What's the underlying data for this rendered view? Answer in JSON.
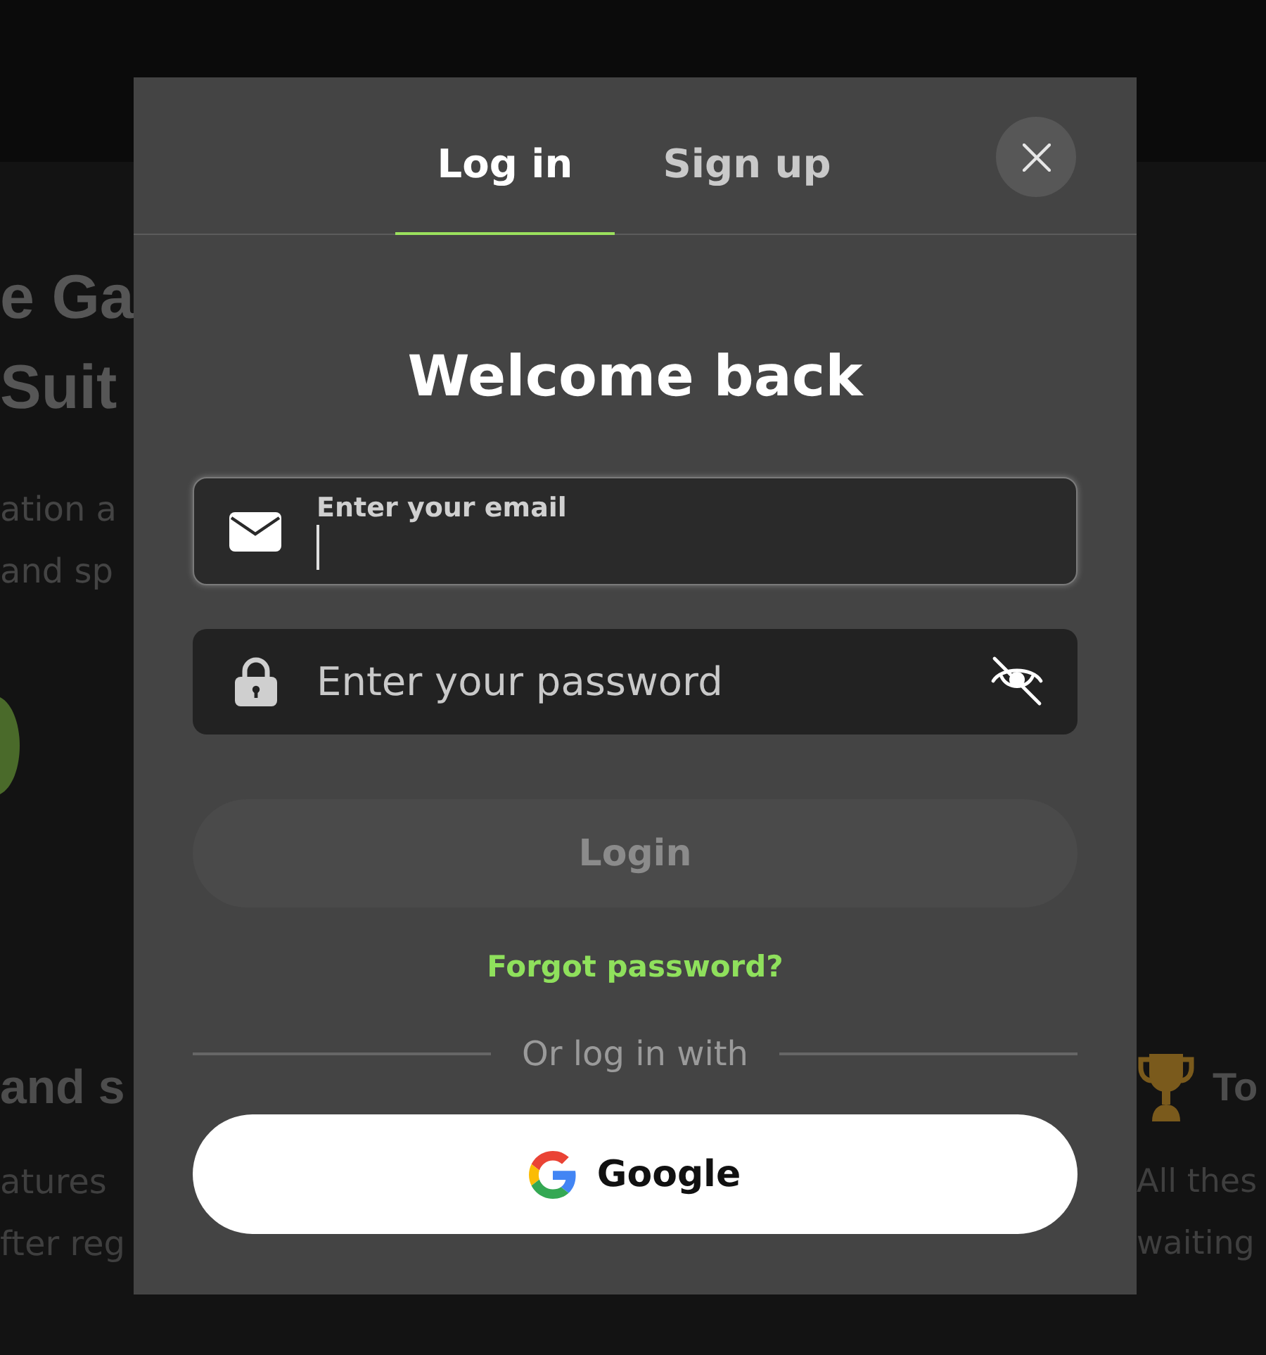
{
  "background": {
    "hero_title_lines": [
      "e Ga",
      "Suit"
    ],
    "hero_text_lines": [
      "ation a",
      "and sp"
    ],
    "features": [
      {
        "title": "and s",
        "lines": [
          "atures",
          "fter reg"
        ]
      },
      {
        "title": "To",
        "lines": [
          "All thes",
          "waiting"
        ]
      }
    ]
  },
  "dialog": {
    "tabs": [
      {
        "label": "Log in",
        "selected": true
      },
      {
        "label": "Sign up",
        "selected": false
      }
    ],
    "title": "Welcome back",
    "email_field": {
      "label": "Enter your email",
      "focused": true
    },
    "password_field": {
      "placeholder": "Enter your password"
    },
    "login_button": {
      "label": "Login",
      "disabled": true
    },
    "forgot_password_link": "Forgot password?",
    "divider_text": "Or log in with",
    "social_buttons": [
      {
        "kind": "google",
        "label": "Google"
      }
    ]
  }
}
